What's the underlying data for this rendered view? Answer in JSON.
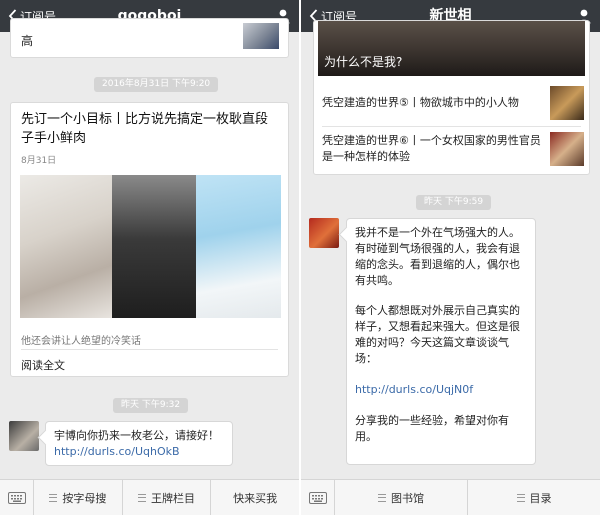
{
  "left": {
    "nav": {
      "back_label": "订阅号",
      "title": "gogoboi"
    },
    "top_card": {
      "tail_text": "高"
    },
    "stamp_top": "2016年8月31日 下午9:20",
    "article": {
      "title": "先订一个小目标丨比方说先搞定一枚耿直段子手小鲜肉",
      "date": "8月31日",
      "summary": "他还会讲让人绝望的冷笑话",
      "read_more": "阅读全文"
    },
    "stamp_bottom": "昨天 下午9:32",
    "message": {
      "line1": "宇博向你扔来一枚老公，请接好！",
      "link": "http://durls.co/UqhOkB"
    },
    "bottom_menu": [
      "按字母搜",
      "王牌栏目",
      "快来买我"
    ]
  },
  "right": {
    "nav": {
      "back_label": "订阅号",
      "title": "新世相"
    },
    "card": {
      "cover_caption": "为什么不是我?",
      "items": [
        "凭空建造的世界⑤丨物欲城市中的小人物",
        "凭空建造的世界⑥丨一个女权国家的男性官员是一种怎样的体验"
      ]
    },
    "stamp": "昨天 下午9:59",
    "message": {
      "para1": "我并不是一个外在气场强大的人。有时碰到气场很强的人，我会有退缩的念头。看到退缩的人，偶尔也有共鸣。",
      "para2": "每个人都想既对外展示自己真实的样子，又想看起来强大。但这是很难的对吗？今天这篇文章谈谈气场：",
      "link": "http://durls.co/UqjN0f",
      "para3": "分享我的一些经验，希望对你有用。"
    },
    "bottom_menu": [
      "图书馆",
      "目录"
    ]
  },
  "colors": {
    "nav_bg": "#363a3f",
    "chat_bg": "#ebebeb",
    "link": "#3b6aa8",
    "stamp_bg": "#d4d4d4"
  },
  "icons": [
    "chevron-left-icon",
    "user-icon",
    "keyboard-icon",
    "menu-bars-icon"
  ]
}
